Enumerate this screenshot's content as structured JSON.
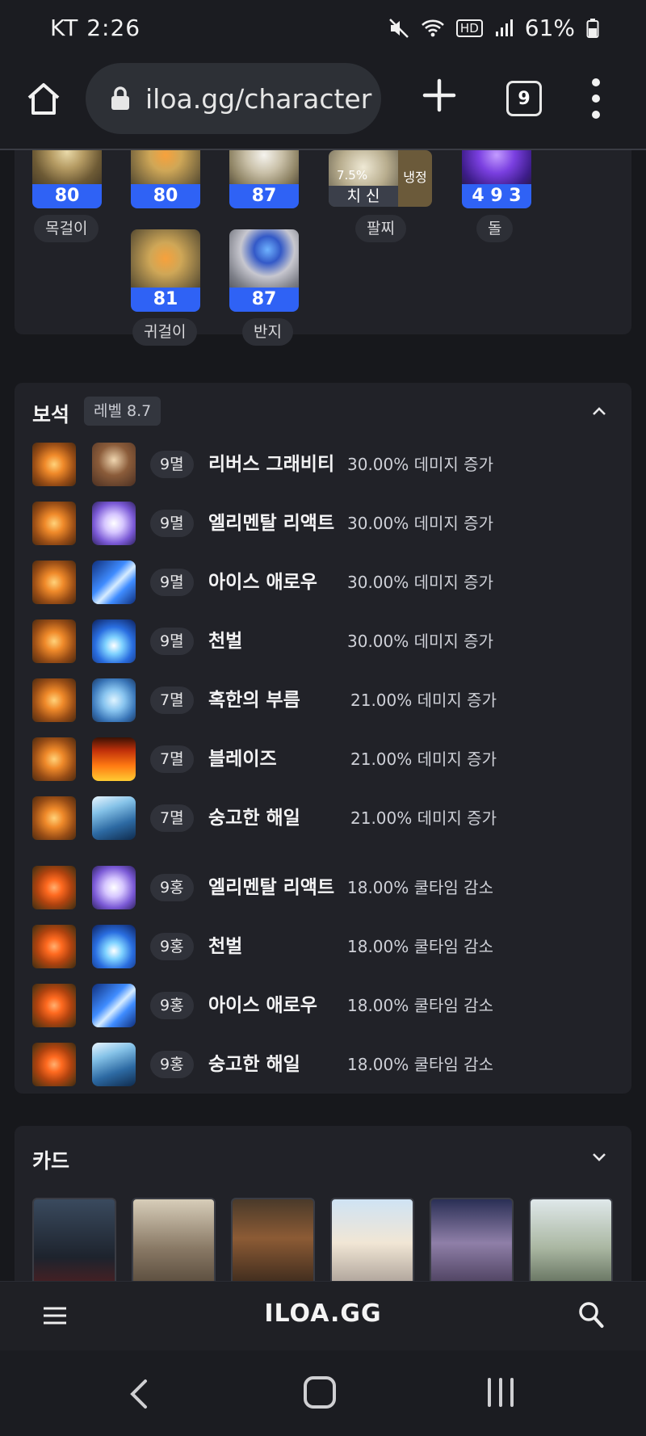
{
  "status_bar": {
    "carrier": "KT",
    "time": "2:26",
    "hd": "HD",
    "battery": "61%"
  },
  "browser": {
    "url": "iloa.gg/character",
    "tab_count": "9"
  },
  "accessories": {
    "items": [
      {
        "value": "80"
      },
      {
        "value": "80"
      },
      {
        "value": "87"
      },
      {
        "value": "4 9 3"
      },
      {
        "value": "81"
      },
      {
        "value": "87"
      }
    ],
    "bracelet": {
      "pct": "7.5%",
      "stat": "치 신",
      "side": "냉정"
    },
    "labels": {
      "necklace": "목걸이",
      "earring": "귀걸이",
      "ring": "반지",
      "bracelet": "팔찌",
      "stone": "돌"
    }
  },
  "gems": {
    "title": "보석",
    "level_badge": "레벨 8.7",
    "rows": [
      {
        "level": "9멸",
        "skill": "리버스 그래비티",
        "effect": "30.00% 데미지 증가"
      },
      {
        "level": "9멸",
        "skill": "엘리멘탈 리액트",
        "effect": "30.00% 데미지 증가"
      },
      {
        "level": "9멸",
        "skill": "아이스 애로우",
        "effect": "30.00% 데미지 증가"
      },
      {
        "level": "9멸",
        "skill": "천벌",
        "effect": "30.00% 데미지 증가"
      },
      {
        "level": "7멸",
        "skill": "혹한의 부름",
        "effect": "21.00% 데미지 증가"
      },
      {
        "level": "7멸",
        "skill": "블레이즈",
        "effect": "21.00% 데미지 증가"
      },
      {
        "level": "7멸",
        "skill": "숭고한 해일",
        "effect": "21.00% 데미지 증가"
      },
      {
        "level": "9홍",
        "skill": "엘리멘탈 리액트",
        "effect": "18.00% 쿨타임 감소"
      },
      {
        "level": "9홍",
        "skill": "천벌",
        "effect": "18.00% 쿨타임 감소"
      },
      {
        "level": "9홍",
        "skill": "아이스 애로우",
        "effect": "18.00% 쿨타임 감소"
      },
      {
        "level": "9홍",
        "skill": "숭고한 해일",
        "effect": "18.00% 쿨타임 감소"
      }
    ]
  },
  "cards": {
    "title": "카드"
  },
  "site": {
    "logo": "ILOA.GG"
  },
  "colors": {
    "accent_blue": "#2f62f5",
    "panel": "#212228",
    "background": "#17181c"
  }
}
